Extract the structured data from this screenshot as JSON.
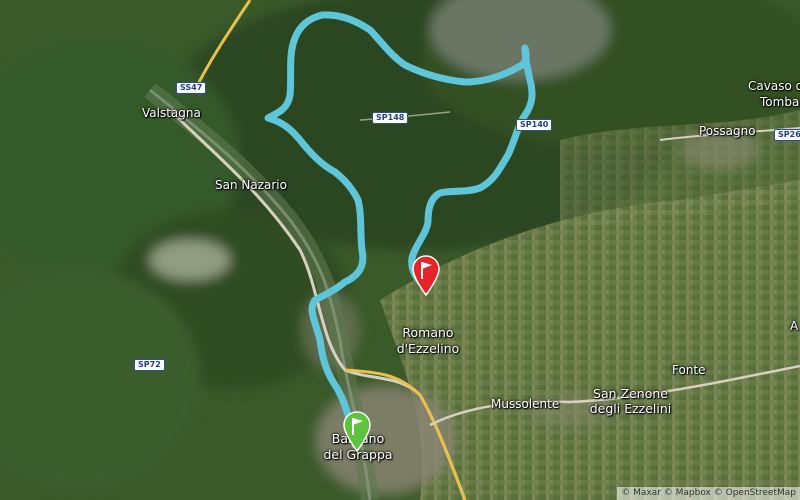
{
  "places": {
    "valstagna": "Valstagna",
    "san_nazario": "San Nazario",
    "cavaso": "Cavaso d",
    "cavaso2": "Tomba",
    "possagno": "Possagno",
    "romano_1": "Romano",
    "romano_2": "d'Ezzelino",
    "fonte": "Fonte",
    "mussolente": "Mussolente",
    "san_zenone_1": "San Zenone",
    "san_zenone_2": "degli Ezzelini",
    "bassano_1": "Bassano",
    "bassano_2": "del Grappa",
    "edge_a": "A"
  },
  "roads": {
    "ss47": "SS47",
    "sp148": "SP148",
    "sp140": "SP140",
    "sp26": "SP26",
    "sp72": "SP72"
  },
  "markers": {
    "start": {
      "icon": "start-flag-icon",
      "color": "#5cc43b"
    },
    "end": {
      "icon": "finish-flag-icon",
      "color": "#e5252a"
    }
  },
  "route": {
    "color": "#5fc6d9"
  },
  "attribution": "© Maxar © Mapbox © OpenStreetMap"
}
